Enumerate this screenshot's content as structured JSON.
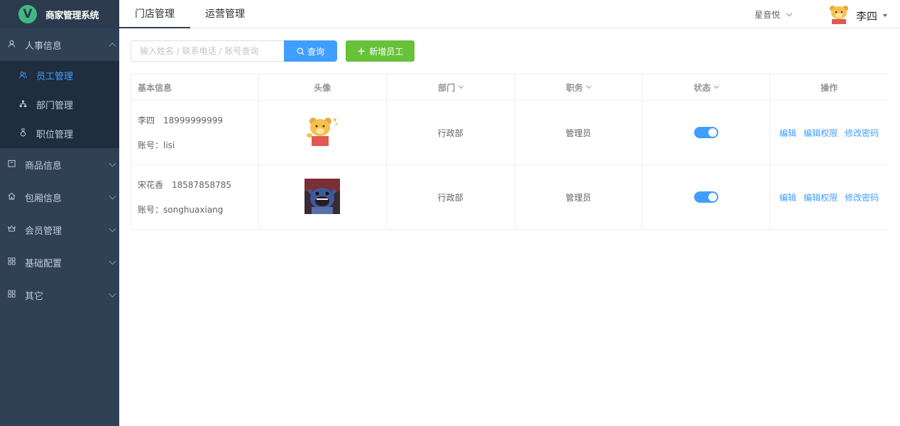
{
  "brand": {
    "logo_letter": "V",
    "title": "商家管理系统"
  },
  "sidebar": {
    "sections": [
      {
        "label": "人事信息",
        "icon": "user-icon",
        "expanded": true
      },
      {
        "label": "商品信息",
        "icon": "box-icon"
      },
      {
        "label": "包厢信息",
        "icon": "home-icon"
      },
      {
        "label": "会员管理",
        "icon": "crown-icon"
      },
      {
        "label": "基础配置",
        "icon": "grid-icon"
      },
      {
        "label": "其它",
        "icon": "grid-icon"
      }
    ],
    "sub_items": [
      {
        "label": "员工管理",
        "icon": "staff-icon",
        "active": true
      },
      {
        "label": "部门管理",
        "icon": "org-icon"
      },
      {
        "label": "职位管理",
        "icon": "badge-icon"
      }
    ]
  },
  "topbar": {
    "tabs": [
      {
        "label": "门店管理",
        "active": true
      },
      {
        "label": "运营管理"
      }
    ],
    "store": "星音悦",
    "user": "李四"
  },
  "toolbar": {
    "search_placeholder": "输入姓名 / 联系电话 / 账号查询",
    "search_button": "查询",
    "add_button": "新增员工"
  },
  "table": {
    "headers": [
      "基本信息",
      "头像",
      "部门",
      "职务",
      "状态",
      "操作"
    ],
    "rows": [
      {
        "name": "李四",
        "phone": "18999999999",
        "account": "账号：lisi",
        "avatar": "bear-avatar",
        "dept": "行政部",
        "role": "管理员",
        "status": true
      },
      {
        "name": "宋花香",
        "phone": "18587858785",
        "account": "账号：songhuaxiang",
        "avatar": "stitch-avatar",
        "dept": "行政部",
        "role": "管理员",
        "status": true
      }
    ],
    "actions": [
      "编辑",
      "编辑权限",
      "修改密码"
    ]
  },
  "colors": {
    "sidebar_bg": "#304156",
    "primary": "#409eff",
    "success": "#67c23a"
  }
}
